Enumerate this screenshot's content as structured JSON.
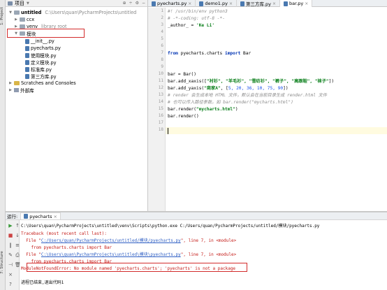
{
  "side_tabs": {
    "project": "1: Project",
    "structure": "7: Structure",
    "favorites": "2: Favorites"
  },
  "project_panel": {
    "title": "项目",
    "tools": [
      "⊕",
      "÷",
      "⚙",
      "−"
    ],
    "tree": [
      {
        "label": "untitled",
        "path": "C:\\Users\\quan\\PycharmProjects\\untitled",
        "kind": "project"
      },
      {
        "label": "ccx",
        "kind": "folder"
      },
      {
        "label": "venv",
        "path": "library root",
        "kind": "folder"
      },
      {
        "label": "模块",
        "kind": "folder"
      },
      {
        "label": "__init__.py",
        "kind": "file"
      },
      {
        "label": "pyecharts.py",
        "kind": "file"
      },
      {
        "label": "使用模块.py",
        "kind": "file"
      },
      {
        "label": "定义模块.py",
        "kind": "file"
      },
      {
        "label": "标准库.py",
        "kind": "file"
      },
      {
        "label": "第三方库.py",
        "kind": "file"
      },
      {
        "label": "Scratches and Consoles",
        "kind": "scratch"
      },
      {
        "label": "外部库",
        "kind": "libs"
      }
    ]
  },
  "editor": {
    "tabs": [
      "pyecharts.py",
      "demo1.py",
      "第三方库.py",
      "bar.py"
    ],
    "active_tab": 3,
    "line_numbers": [
      "1",
      "2",
      "3",
      "4",
      "5",
      "6",
      "7",
      "8",
      "9",
      "10",
      "11",
      "12",
      "13",
      "14",
      "15",
      "16",
      "17",
      "18"
    ],
    "lines": {
      "l1": "#! /usr/bin/env python3",
      "l2": "# -*-coding: utf-8 -*-",
      "l3a": "_author_ = ",
      "l3b": "'Ke Li'",
      "l7a": "from",
      "l7b": " pyecharts.charts ",
      "l7c": "import",
      "l7d": " Bar",
      "l10": "bar = Bar()",
      "l11a": "bar.add_xaxis([",
      "l11b": "\"衬衫\", \"羊毛衫\", \"雪纺衫\", \"裤子\", \"高跟鞋\", \"袜子\"",
      "l11c": "])",
      "l12a": "bar.add_yaxis(",
      "l12b": "\"商家A\"",
      "l12c": ", [",
      "l12d": "5, 20, 36, 10, 75, 90",
      "l12e": "])",
      "l13": "# render 会生成本地 HTML 文件，默认会在当前目录生成 render.html 文件",
      "l14": "# 也可以传入路径参数，如 bar.render(\"mycharts.html\")",
      "l15a": "bar.render(",
      "l15b": "\"mycharts.html\"",
      "l15c": ")",
      "l16": "bar.render()"
    }
  },
  "run_panel": {
    "label": "运行:",
    "tab": "pyecharts",
    "console": {
      "cmd": "C:\\Users\\quan\\PycharmProjects\\untitled\\venv\\Scripts\\python.exe C:/Users/quan/PycharmProjects/untitled/模块/pyecharts.py",
      "tb": "Traceback (most recent call last):",
      "f1a": "  File \"",
      "f1link": "C:/Users/quan/PycharmProjects/untitled/模块/pyecharts.py",
      "f1b": "\", line 7, in <module>",
      "imp1": "    from pyecharts.charts import Bar",
      "f2a": "  File \"",
      "f2link": "C:\\Users\\quan\\PycharmProjects\\untitled\\模块\\pyecharts.py",
      "f2b": "\", line 7, in <module>",
      "imp2": "    from pyecharts.charts import Bar",
      "err": "ModuleNotFoundError: No module named 'pyecharts.charts'; 'pyecharts' is not a package",
      "exit": "进程已结束,退出代码1"
    }
  }
}
